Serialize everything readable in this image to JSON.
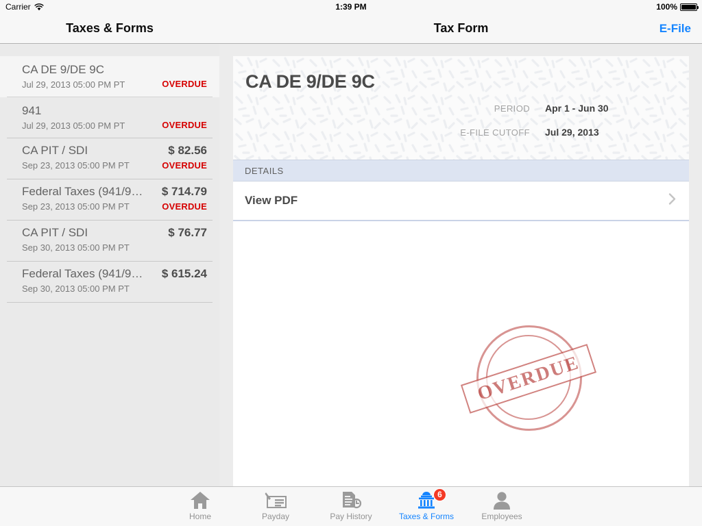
{
  "status_bar": {
    "carrier": "Carrier",
    "wifi_icon": "wifi-icon",
    "time": "1:39 PM",
    "battery_percent": "100%",
    "battery_icon": "battery-full-icon"
  },
  "nav_bar": {
    "left_title": "Taxes & Forms",
    "center_title": "Tax Form",
    "efile_label": "E-File",
    "accent_color": "#1484ff"
  },
  "master_list": {
    "items": [
      {
        "title": "CA DE 9/DE 9C",
        "date": "Jul 29, 2013 05:00 PM PT",
        "amount": "",
        "status": "OVERDUE",
        "selected": true
      },
      {
        "title": "941",
        "date": "Jul 29, 2013 05:00 PM PT",
        "amount": "",
        "status": "OVERDUE",
        "selected": false
      },
      {
        "title": "CA PIT / SDI",
        "date": "Sep 23, 2013 05:00 PM PT",
        "amount": "$ 82.56",
        "status": "OVERDUE",
        "selected": false
      },
      {
        "title": "Federal Taxes (941/9…",
        "date": "Sep 23, 2013 05:00 PM PT",
        "amount": "$ 714.79",
        "status": "OVERDUE",
        "selected": false
      },
      {
        "title": "CA PIT / SDI",
        "date": "Sep 30, 2013 05:00 PM PT",
        "amount": "$ 76.77",
        "status": "",
        "selected": false
      },
      {
        "title": "Federal Taxes (941/9…",
        "date": "Sep 30, 2013 05:00 PM PT",
        "amount": "$ 615.24",
        "status": "",
        "selected": false
      }
    ],
    "overdue_color": "#d60000"
  },
  "detail": {
    "form_title": "CA DE 9/DE 9C",
    "meta": [
      {
        "label": "PERIOD",
        "value": "Apr 1 - Jun 30"
      },
      {
        "label": "E-FILE CUTOFF",
        "value": "Jul 29, 2013"
      }
    ],
    "details_section_label": "DETAILS",
    "view_pdf_label": "View PDF",
    "chevron_icon": "chevron-right-icon",
    "stamp_text": "OVERDUE",
    "stamp_color": "#bb4b48"
  },
  "tab_bar": {
    "tabs": [
      {
        "label": "Home",
        "icon": "home-icon",
        "active": false,
        "badge": ""
      },
      {
        "label": "Payday",
        "icon": "check-pen-icon",
        "active": false,
        "badge": ""
      },
      {
        "label": "Pay History",
        "icon": "document-clock-icon",
        "active": false,
        "badge": ""
      },
      {
        "label": "Taxes & Forms",
        "icon": "government-building-icon",
        "active": true,
        "badge": "6"
      },
      {
        "label": "Employees",
        "icon": "person-icon",
        "active": false,
        "badge": ""
      }
    ],
    "active_color": "#1484ff",
    "badge_color": "#f43a26"
  }
}
